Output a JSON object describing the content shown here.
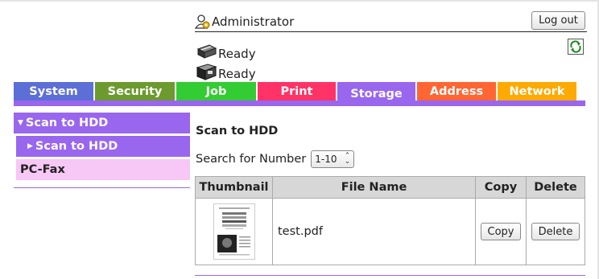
{
  "header": {
    "user_label": "Administrator",
    "logout_label": "Log out",
    "statuses": [
      "Ready",
      "Ready"
    ]
  },
  "tabs": [
    {
      "label": "System",
      "color": "#5b6fd6"
    },
    {
      "label": "Security",
      "color": "#6c9a2e"
    },
    {
      "label": "Job",
      "color": "#33cc33"
    },
    {
      "label": "Print",
      "color": "#ff3366"
    },
    {
      "label": "Storage",
      "color": "#9966ee",
      "active": true
    },
    {
      "label": "Address",
      "color": "#ff6633"
    },
    {
      "label": "Network",
      "color": "#ffaa00"
    }
  ],
  "menu": {
    "items": [
      "Scan to HDD",
      "Scan to HDD",
      "PC-Fax"
    ]
  },
  "main": {
    "title": "Scan to HDD",
    "search_label": "Search for Number",
    "search_value": "1-10",
    "columns": [
      "Thumbnail",
      "File Name",
      "Copy",
      "Delete"
    ],
    "rows": [
      {
        "file_name": "test.pdf",
        "copy_label": "Copy",
        "delete_label": "Delete"
      }
    ]
  },
  "colors": {
    "accent": "#9966ee",
    "menu_sub": "#f7c7f5",
    "table_header": "#d7d7d7"
  }
}
